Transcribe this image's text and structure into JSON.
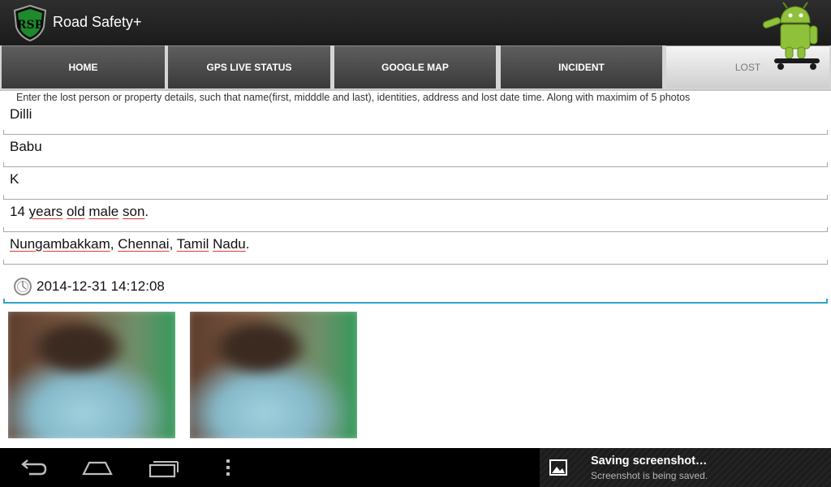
{
  "app": {
    "title": "Road Safety+",
    "logo_icon": "rsp-shield-logo-icon",
    "mascot_icon": "android-skateboard-icon"
  },
  "tabs": [
    {
      "label": "HOME",
      "selected": false
    },
    {
      "label": "GPS LIVE STATUS",
      "selected": false
    },
    {
      "label": "GOOGLE MAP",
      "selected": false
    },
    {
      "label": "INCIDENT",
      "selected": false
    },
    {
      "label": "LOST",
      "selected": true
    }
  ],
  "form": {
    "instructions": "Enter the lost person or property details, such that name(first, midddle and last), identities, address and lost date time. Along with maximim of 5 photos",
    "first_name": "Dilli",
    "middle_name": "Babu",
    "last_name": "K",
    "identities": {
      "num": "14",
      "w1": "years",
      "w2": "old",
      "w3": "male",
      "w4": "son",
      "end": "."
    },
    "address": {
      "p1": "Nungambakkam",
      "sep1": ", ",
      "p2": "Chennai",
      "sep2": ", ",
      "p3": "Tamil",
      "sp": " ",
      "p4": "Nadu",
      "end": "."
    },
    "datetime": "2014-12-31 14:12:08",
    "clock_icon": "clock-icon",
    "photos": [
      "photo-1",
      "photo-2"
    ]
  },
  "navbar": {
    "back_icon": "back-icon",
    "home_icon": "home-icon",
    "recents_icon": "recent-apps-icon",
    "menu_icon": "overflow-menu-icon"
  },
  "notification": {
    "title": "Saving screenshot…",
    "subtitle": "Screenshot is being saved.",
    "icon": "image-icon"
  },
  "colors": {
    "focus_accent": "#33a0cc",
    "spellcheck": "#e53935",
    "actionbar": "#222222"
  }
}
